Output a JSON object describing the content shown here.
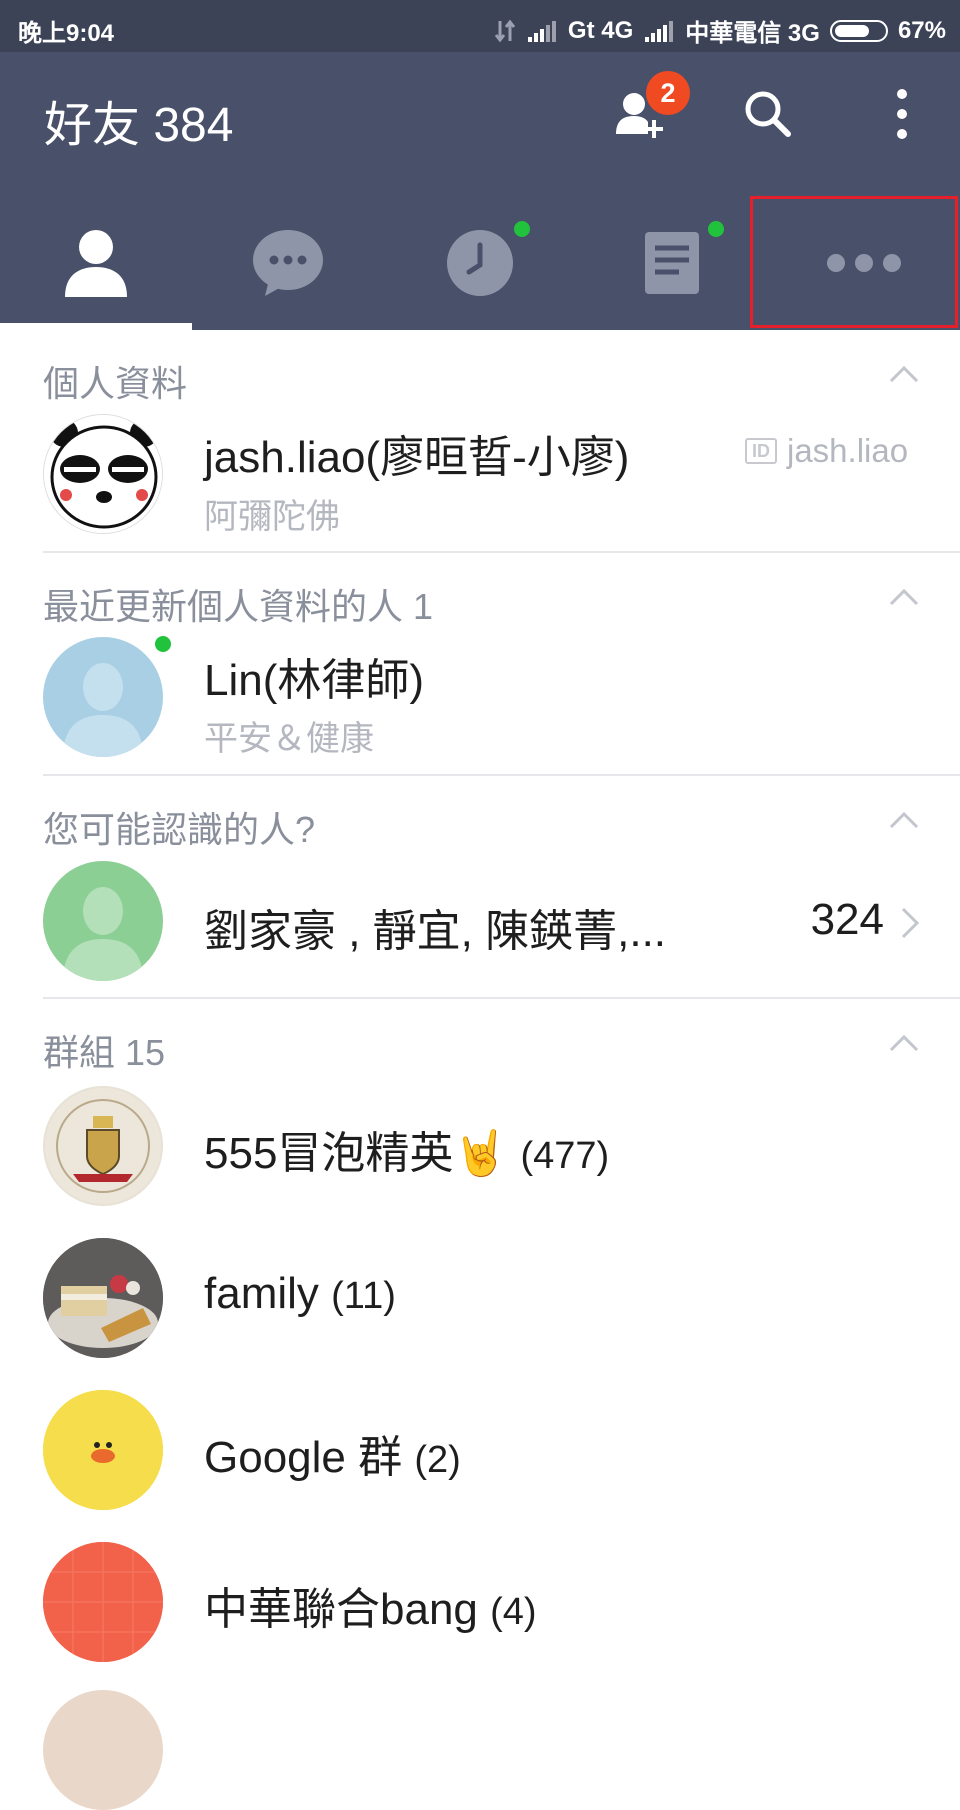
{
  "status_bar": {
    "time": "晚上9:04",
    "network1": "Gt 4G",
    "carrier": "中華電信 3G",
    "battery": "67%"
  },
  "header": {
    "title": "好友 384",
    "add_friend_badge": "2"
  },
  "tabs": [
    {
      "name": "friends",
      "icon": "person-icon",
      "active": true
    },
    {
      "name": "chats",
      "icon": "chat-bubble-icon",
      "active": false
    },
    {
      "name": "timeline",
      "icon": "clock-icon",
      "active": false,
      "dot": true
    },
    {
      "name": "news",
      "icon": "document-icon",
      "active": false,
      "dot": true
    },
    {
      "name": "more",
      "icon": "more-dots-icon",
      "active": false
    }
  ],
  "profile": {
    "section_title": "個人資料",
    "name": "jash.liao(廖晅晢-小廖)",
    "status": "阿彌陀佛",
    "id_label": "ID",
    "id_value": "jash.liao"
  },
  "recent": {
    "section_title": "最近更新個人資料的人 1",
    "name": "Lin(林律師)",
    "status": "平安＆健康"
  },
  "pymk": {
    "section_title": "您可能認識的人?",
    "names": "劉家豪 , 靜宜, 陳鍈菁,...",
    "count": "324"
  },
  "groups": {
    "section_title": "群組 15",
    "items": [
      {
        "name": "555冒泡精英🤘",
        "count": "(477)"
      },
      {
        "name": "family",
        "count": "(11)"
      },
      {
        "name": "Google 群",
        "count": "(2)"
      },
      {
        "name": "中華聯合bang",
        "count": "(4)"
      }
    ]
  },
  "colors": {
    "header": "#48506a",
    "status_bar": "#3c4357",
    "badge": "#f04a22",
    "online_dot": "#22c33c",
    "highlight": "#e5202a"
  }
}
